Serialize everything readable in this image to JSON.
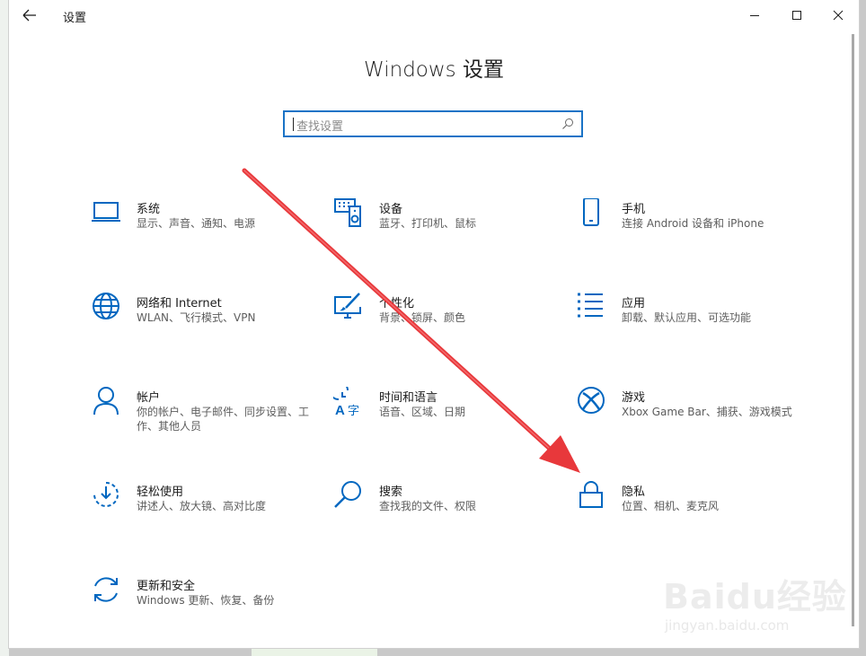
{
  "window": {
    "title": "设置",
    "heading": "Windows 设置",
    "controls": {
      "minimize": "minimize-icon",
      "maximize": "maximize-icon",
      "close": "close-icon"
    }
  },
  "search": {
    "placeholder": "查找设置",
    "icon": "search-icon"
  },
  "colors": {
    "accent": "#0067c0",
    "arrow": "#e8383b"
  },
  "tiles": [
    {
      "title": "系统",
      "desc": "显示、声音、通知、电源",
      "icon": "laptop-icon"
    },
    {
      "title": "设备",
      "desc": "蓝牙、打印机、鼠标",
      "icon": "keyboard-speaker-icon"
    },
    {
      "title": "手机",
      "desc": "连接 Android 设备和 iPhone",
      "icon": "phone-icon"
    },
    {
      "title": "网络和 Internet",
      "desc": "WLAN、飞行模式、VPN",
      "icon": "globe-icon"
    },
    {
      "title": "个性化",
      "desc": "背景、锁屏、颜色",
      "icon": "paint-monitor-icon"
    },
    {
      "title": "应用",
      "desc": "卸载、默认应用、可选功能",
      "icon": "apps-list-icon"
    },
    {
      "title": "帐户",
      "desc": "你的帐户、电子邮件、同步设置、工作、其他人员",
      "icon": "person-icon"
    },
    {
      "title": "时间和语言",
      "desc": "语音、区域、日期",
      "icon": "time-language-icon"
    },
    {
      "title": "游戏",
      "desc": "Xbox Game Bar、捕获、游戏模式",
      "icon": "xbox-icon"
    },
    {
      "title": "轻松使用",
      "desc": "讲述人、放大镜、高对比度",
      "icon": "ease-of-access-icon"
    },
    {
      "title": "搜索",
      "desc": "查找我的文件、权限",
      "icon": "magnifier-icon"
    },
    {
      "title": "隐私",
      "desc": "位置、相机、麦克风",
      "icon": "lock-icon"
    },
    {
      "title": "更新和安全",
      "desc": "Windows 更新、恢复、备份",
      "icon": "sync-icon"
    }
  ],
  "watermark": {
    "brand": "Baidu经验",
    "url": "jingyan.baidu.com"
  }
}
